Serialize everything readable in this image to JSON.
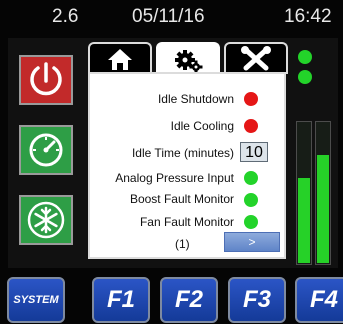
{
  "status_bar": {
    "version": "2.6",
    "date": "05/11/16",
    "time": "16:42"
  },
  "side_buttons": [
    {
      "name": "power",
      "icon": "power-icon",
      "color": "#c22a2a"
    },
    {
      "name": "gauge",
      "icon": "gauge-icon",
      "color": "#2e9e46"
    },
    {
      "name": "fan",
      "icon": "fan-snowflake-icon",
      "color": "#2e9e46"
    }
  ],
  "tabs": [
    {
      "icon": "home-icon",
      "active": false
    },
    {
      "icon": "gears-icon",
      "active": true
    },
    {
      "icon": "tools-icon",
      "active": false
    }
  ],
  "panel": {
    "rows": [
      {
        "label": "Idle Shutdown",
        "status": "red"
      },
      {
        "label": "Idle Cooling",
        "status": "red"
      },
      {
        "label": "Idle Time (minutes)",
        "value": "10"
      },
      {
        "label": "Analog Pressure Input",
        "status": "green"
      },
      {
        "label": "Boost Fault Monitor",
        "status": "green"
      },
      {
        "label": "Fan Fault Monitor",
        "status": "green"
      }
    ],
    "page": "(1)",
    "next_label": ">"
  },
  "right_indicators": {
    "dots": [
      "green",
      "green"
    ],
    "bars": [
      {
        "level": 0.6
      },
      {
        "level": 0.76
      }
    ]
  },
  "function_keys": [
    {
      "label": "SYSTEM"
    },
    {
      "label": "F1"
    },
    {
      "label": "F2"
    },
    {
      "label": "F3"
    },
    {
      "label": "F4"
    }
  ],
  "colors": {
    "status_red": "#e51616",
    "status_green": "#23d32a",
    "key_blue": "#1f47b3"
  }
}
